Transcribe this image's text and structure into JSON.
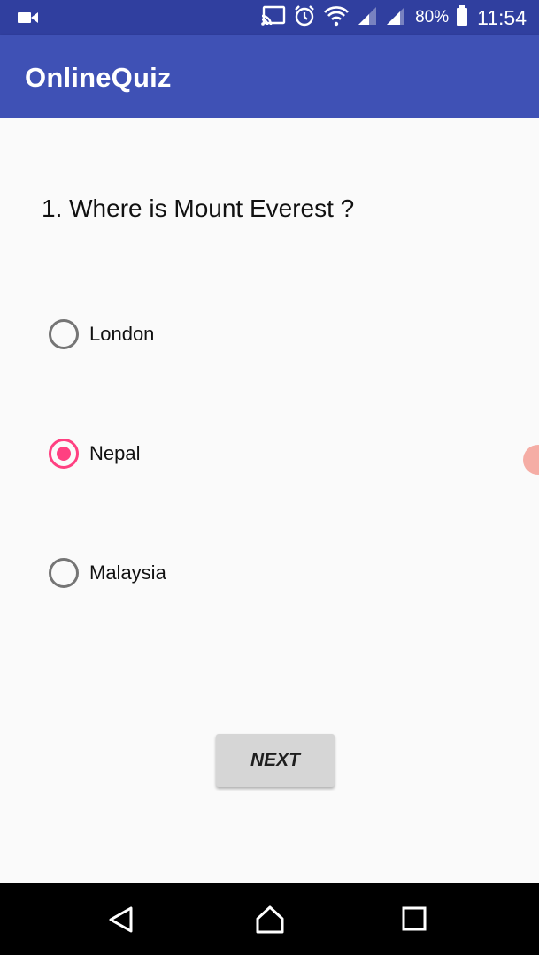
{
  "status_bar": {
    "battery": "80%",
    "time": "11:54",
    "icons": [
      "video-camera-icon",
      "cast-icon",
      "alarm-icon",
      "wifi-icon",
      "signal-icon",
      "signal-icon",
      "battery-icon"
    ]
  },
  "app_bar": {
    "title": "OnlineQuiz"
  },
  "quiz": {
    "question": "1. Where is Mount Everest ?",
    "options": [
      {
        "label": "London",
        "selected": false
      },
      {
        "label": "Nepal",
        "selected": true
      },
      {
        "label": "Malaysia",
        "selected": false
      }
    ],
    "next_label": "NEXT"
  },
  "nav_bar": {
    "buttons": [
      "back-icon",
      "home-icon",
      "recents-icon"
    ]
  },
  "colors": {
    "status_bar": "#303f9f",
    "app_bar": "#3f51b5",
    "accent": "#ff4081",
    "button": "#d6d6d6",
    "background": "#fafafa"
  }
}
